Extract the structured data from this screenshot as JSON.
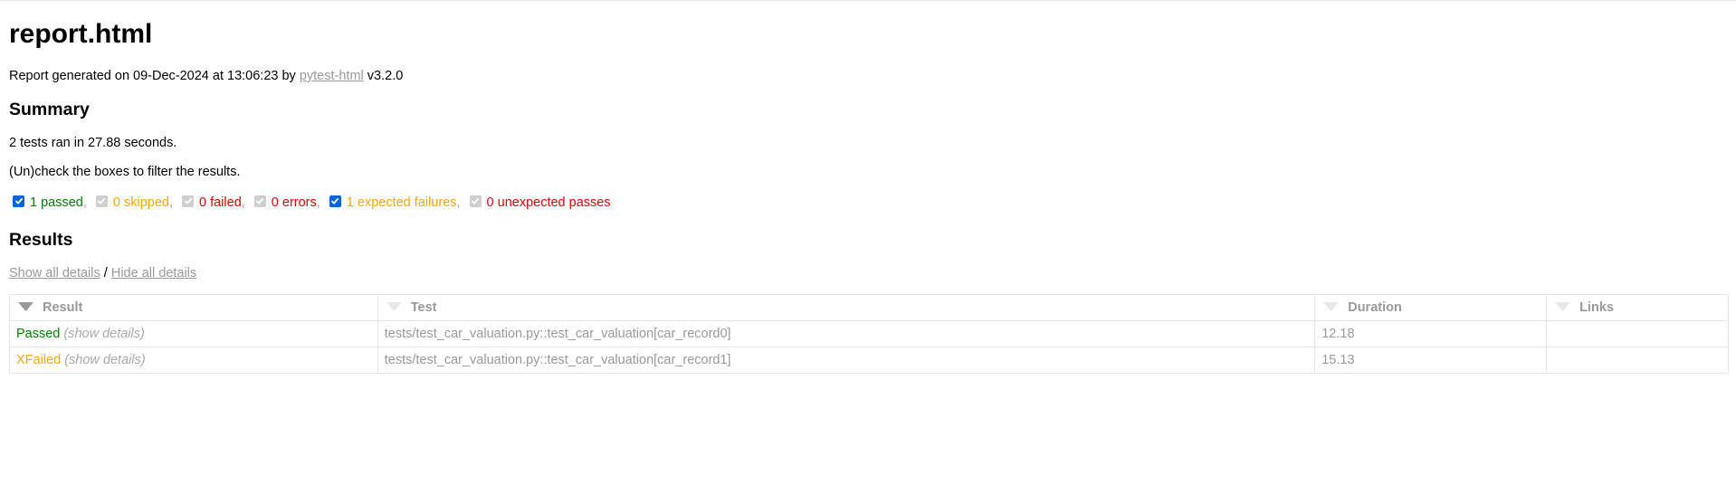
{
  "report": {
    "title": "report.html",
    "generated_prefix": "Report generated on 09-Dec-2024 at 13:06:23 by ",
    "generator_link": "pytest-html",
    "generator_version": " v3.2.0"
  },
  "summary": {
    "heading": "Summary",
    "ran_text": "2 tests ran in 27.88 seconds.",
    "filter_hint": "(Un)check the boxes to filter the results.",
    "filters": [
      {
        "label": "1 passed",
        "checked": true,
        "color": "#008000"
      },
      {
        "label": "0 skipped",
        "checked": true,
        "disabled": true,
        "color": "#ffa500"
      },
      {
        "label": "0 failed",
        "checked": true,
        "disabled": true,
        "color": "#e60000"
      },
      {
        "label": "0 errors",
        "checked": true,
        "disabled": true,
        "color": "#e60000"
      },
      {
        "label": "1 expected failures",
        "checked": true,
        "color": "#ffa500"
      },
      {
        "label": "0 unexpected passes",
        "checked": true,
        "disabled": true,
        "color": "#e60000"
      }
    ],
    "separator": ","
  },
  "results": {
    "heading": "Results",
    "show_all": "Show all details",
    "slash": " / ",
    "hide_all": "Hide all details",
    "columns": [
      "Result",
      "Test",
      "Duration",
      "Links"
    ],
    "rows": [
      {
        "result": "Passed",
        "show_details": "(show details)",
        "test": "tests/test_car_valuation.py::test_car_valuation[car_record0]",
        "duration": "12.18",
        "links": ""
      },
      {
        "result": "XFailed",
        "show_details": "(show details)",
        "test": "tests/test_car_valuation.py::test_car_valuation[car_record1]",
        "duration": "15.13",
        "links": ""
      }
    ]
  }
}
